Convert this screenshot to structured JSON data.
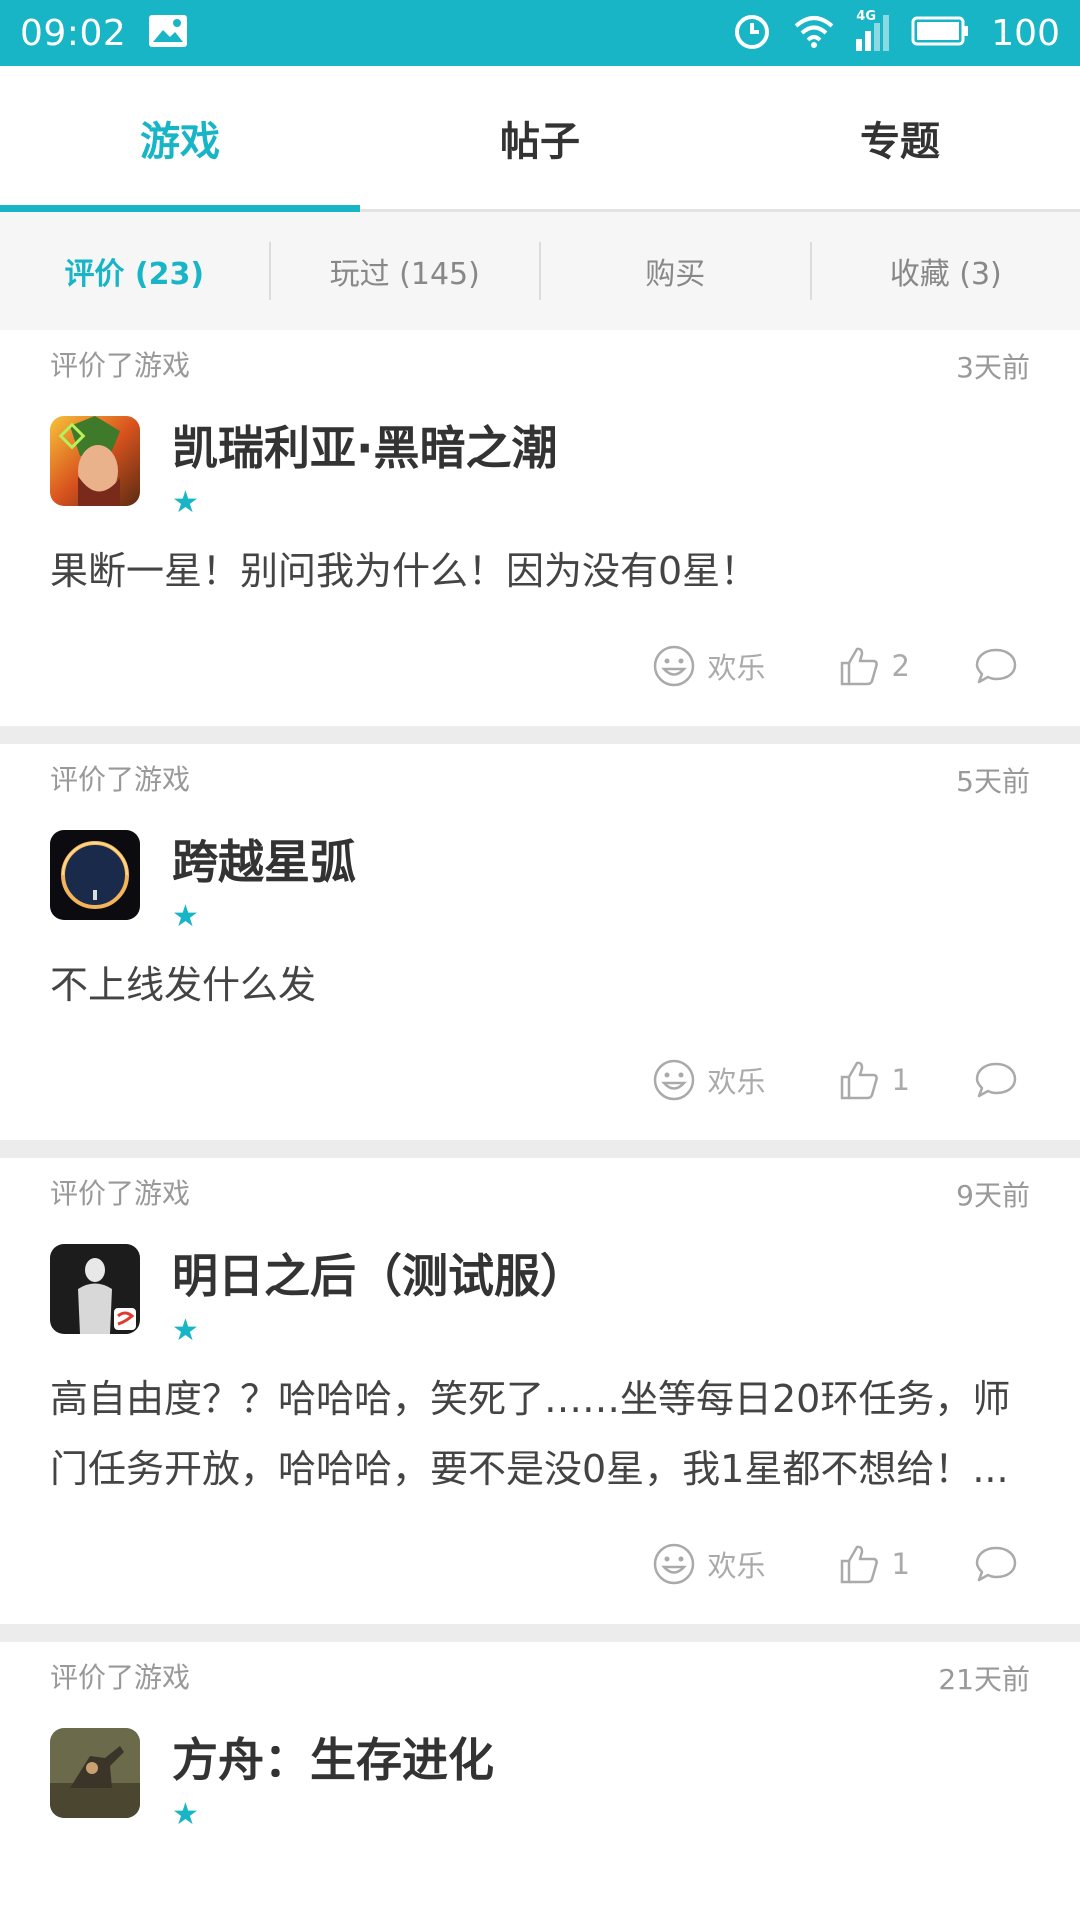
{
  "status_bar": {
    "time": "09:02",
    "network": "4G",
    "battery": "100",
    "icons": [
      "image-icon",
      "alarm-icon",
      "wifi-icon",
      "signal-icon",
      "battery-icon"
    ]
  },
  "top_tabs": [
    {
      "label": "游戏",
      "active": true
    },
    {
      "label": "帖子",
      "active": false
    },
    {
      "label": "专题",
      "active": false
    }
  ],
  "sub_tabs": [
    {
      "label": "评价 (23)",
      "active": true
    },
    {
      "label": "玩过 (145)",
      "active": false
    },
    {
      "label": "购买",
      "active": false
    },
    {
      "label": "收藏 (3)",
      "active": false
    }
  ],
  "colors": {
    "accent": "#17b5c6"
  },
  "reviews": [
    {
      "type_label": "评价了游戏",
      "time_ago": "3天前",
      "game_title": "凯瑞利亚·黑暗之潮",
      "stars": 1,
      "text": "果断一星！别问我为什么！因为没有0星！",
      "mood_label": "欢乐",
      "likes": "2"
    },
    {
      "type_label": "评价了游戏",
      "time_ago": "5天前",
      "game_title": "跨越星弧",
      "stars": 1,
      "text": "不上线发什么发",
      "mood_label": "欢乐",
      "likes": "1"
    },
    {
      "type_label": "评价了游戏",
      "time_ago": "9天前",
      "game_title": "明日之后（测试服）",
      "stars": 1,
      "text": "高自由度？？哈哈哈，笑死了……坐等每日20环任务，师门任务开放，哈哈哈，要不是没0星，我1星都不想给！...",
      "mood_label": "欢乐",
      "likes": "1"
    },
    {
      "type_label": "评价了游戏",
      "time_ago": "21天前",
      "game_title": "方舟：生存进化",
      "stars": 1
    }
  ]
}
